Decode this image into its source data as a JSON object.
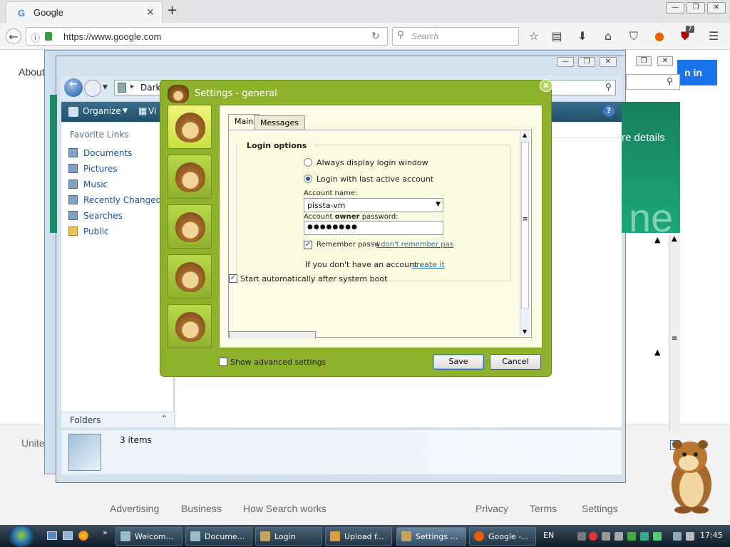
{
  "browser": {
    "tab_title": "Google",
    "tab_favicon": "G",
    "close_glyph": "×",
    "new_tab_glyph": "+",
    "url": "https://www.google.com",
    "search_placeholder": "Search",
    "addon_badge": "7",
    "window_buttons": [
      "—",
      "❐",
      "✕"
    ]
  },
  "google": {
    "about": "About",
    "signin": "n in",
    "promo_line": "re details",
    "promo_big": "ne",
    "country": "Unite",
    "footer_left": [
      "Advertising",
      "Business",
      "How Search works"
    ],
    "footer_right": [
      "Privacy",
      "Terms",
      "Settings"
    ]
  },
  "explorer": {
    "address": "Dark",
    "organize": "Organize",
    "views": "Vi",
    "favorite_links_title": "Favorite Links",
    "links": [
      "Documents",
      "Pictures",
      "Music",
      "Recently Changed",
      "Searches",
      "Public"
    ],
    "folders": "Folders",
    "items_count": "3 items",
    "help": "?"
  },
  "dialog": {
    "title": "Settings - general",
    "close": "x",
    "tabs": [
      "Main",
      "Messages"
    ],
    "group_title": "Login options",
    "radio_always": "Always display login window",
    "radio_last": "Login with last active account",
    "account_name_label": "Account name:",
    "account_name_value": "pissta-vm",
    "password_label_pre": "Account ",
    "password_label_bold": "owner",
    "password_label_post": " password:",
    "password_value": "●●●●●●●●",
    "remember_label": "Remember passw",
    "forgot_link": "I don't remember pas",
    "no_account_text": "If you don't have an account - ",
    "create_link": "create it",
    "autostart_label": "Start automatically after system boot",
    "show_advanced": "Show advanced settings",
    "save": "Save",
    "cancel": "Cancel",
    "check_glyph": "✓"
  },
  "taskbar": {
    "quick_more": "»",
    "buttons": [
      "Welcom...",
      "Docume...",
      "Login",
      "Upload f...",
      "Settings ...",
      "Google -..."
    ],
    "active_index": 4,
    "lang": "EN",
    "time": "17:45"
  },
  "colors": {
    "dialog_green": "#8fb22d",
    "google_blue": "#1a73e8",
    "explorer_toolbar": "#1f4e6a"
  }
}
